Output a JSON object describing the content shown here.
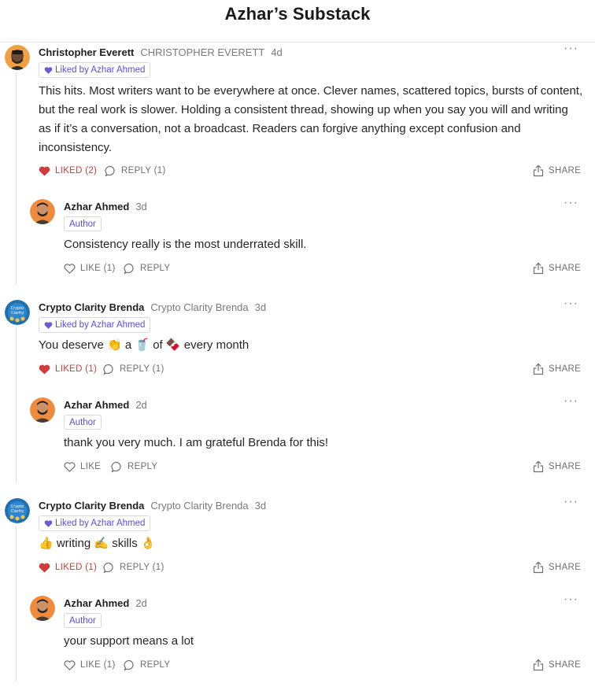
{
  "header": {
    "title": "Azhar’s Substack"
  },
  "labels": {
    "share": "SHARE",
    "more": "···"
  },
  "colors": {
    "liked_red": "#d23b3b",
    "accent_purple": "#5b4fd8"
  },
  "comments": [
    {
      "name": "Christopher Everett",
      "handle": "CHRISTOPHER EVERETT",
      "time": "4d",
      "badge": "Liked by Azhar Ahmed",
      "text": "This hits. Most writers want to be everywhere at once. Clever names, scattered topics, bursts of content, but the real work is slower. Holding a consistent thread, showing up when you say you will and writing as if it’s a conversation, not a broadcast. Readers can forgive anything except confusion and inconsistency.",
      "like_label": "LIKED (2)",
      "reply_label": "REPLY (1)",
      "reply": {
        "name": "Azhar Ahmed",
        "time": "3d",
        "badge": "Author",
        "text": "Consistency really is the most underrated skill.",
        "like_label": "LIKE (1)",
        "reply_label": "REPLY"
      }
    },
    {
      "name": "Crypto Clarity Brenda",
      "handle": "Crypto Clarity Brenda",
      "time": "3d",
      "badge": "Liked by Azhar Ahmed",
      "text": "You deserve 👏 a 🥤 of 🍫 every month",
      "like_label": "LIKED (1)",
      "reply_label": "REPLY (1)",
      "reply": {
        "name": "Azhar Ahmed",
        "time": "2d",
        "badge": "Author",
        "text": "thank you very much. I am grateful Brenda for this!",
        "like_label": "LIKE",
        "reply_label": "REPLY"
      }
    },
    {
      "name": "Crypto Clarity Brenda",
      "handle": "Crypto Clarity Brenda",
      "time": "3d",
      "badge": "Liked by Azhar Ahmed",
      "text": "👍 writing ✍️ skills 👌",
      "like_label": "LIKED (1)",
      "reply_label": "REPLY (1)",
      "reply": {
        "name": "Azhar Ahmed",
        "time": "2d",
        "badge": "Author",
        "text": "your support means a lot",
        "like_label": "LIKE (1)",
        "reply_label": "REPLY"
      }
    }
  ]
}
